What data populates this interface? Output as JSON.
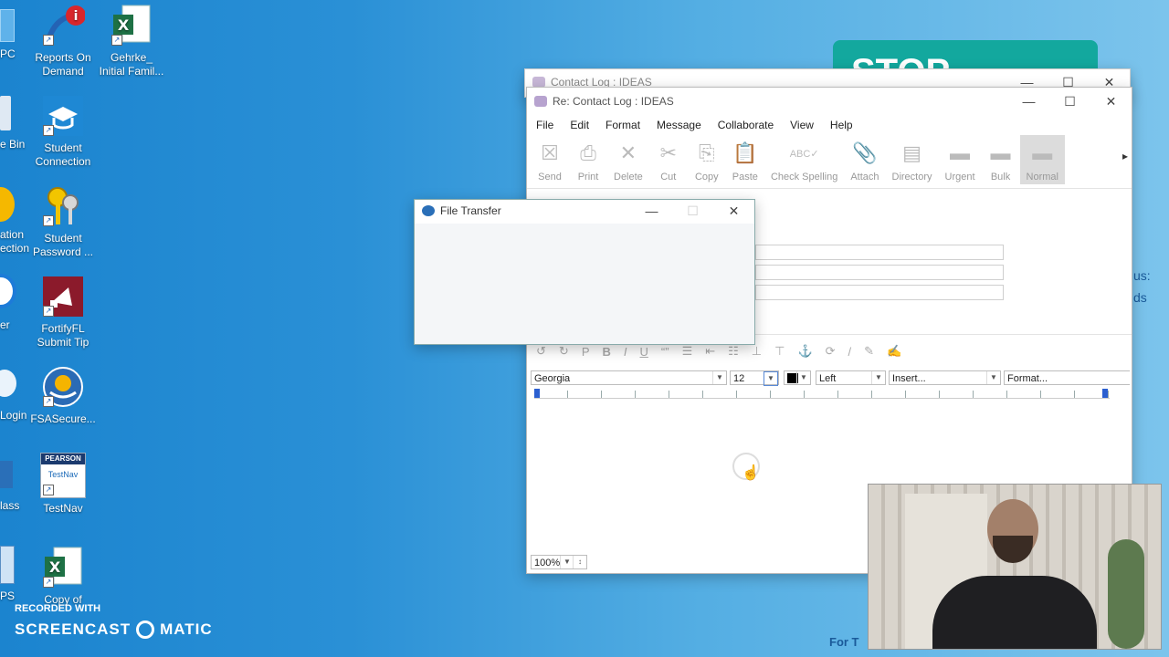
{
  "desktop": {
    "left_partial_labels": [
      "PC",
      "e Bin",
      "ation",
      "ection",
      "er",
      "Login",
      "lass",
      "PS"
    ],
    "icons": [
      {
        "label": "Reports On Demand"
      },
      {
        "label": "Gehrke_ Initial Famil..."
      },
      {
        "label": "Student Connection"
      },
      {
        "label": "Student Password ..."
      },
      {
        "label": "FortifyFL Submit Tip"
      },
      {
        "label": "FSASecure..."
      },
      {
        "label": "TestNav"
      },
      {
        "label": "Copy of"
      }
    ],
    "testnav_brand": "PEARSON",
    "testnav_mark": "TestNav"
  },
  "background": {
    "promo_text": "STOP",
    "side_text_1": "us:",
    "side_text_2": "ds",
    "bottom_text": "For T"
  },
  "back_window": {
    "title": "Contact Log : IDEAS"
  },
  "main_window": {
    "title": "Re: Contact Log : IDEAS",
    "menu": [
      "File",
      "Edit",
      "Format",
      "Message",
      "Collaborate",
      "View",
      "Help"
    ],
    "toolbar": [
      {
        "label": "Send",
        "icon": "send-icon"
      },
      {
        "label": "Print",
        "icon": "print-icon"
      },
      {
        "label": "Delete",
        "icon": "delete-icon"
      },
      {
        "label": "Cut",
        "icon": "cut-icon"
      },
      {
        "label": "Copy",
        "icon": "copy-icon"
      },
      {
        "label": "Paste",
        "icon": "paste-icon"
      },
      {
        "label": "Check Spelling",
        "icon": "spell-check-icon"
      },
      {
        "label": "Attach",
        "icon": "paperclip-icon"
      },
      {
        "label": "Directory",
        "icon": "directory-icon"
      },
      {
        "label": "Urgent",
        "icon": "urgent-icon"
      },
      {
        "label": "Bulk",
        "icon": "bulk-icon"
      },
      {
        "label": "Normal",
        "icon": "normal-icon"
      }
    ],
    "font_family": "Georgia",
    "font_size": "12",
    "alignment": "Left",
    "insert": "Insert...",
    "format": "Format...",
    "zoom": "100%"
  },
  "dialog": {
    "title": "File Transfer"
  },
  "watermark": {
    "line1": "RECORDED WITH",
    "line2": "SCREENCAST",
    "line3": "MATIC"
  }
}
